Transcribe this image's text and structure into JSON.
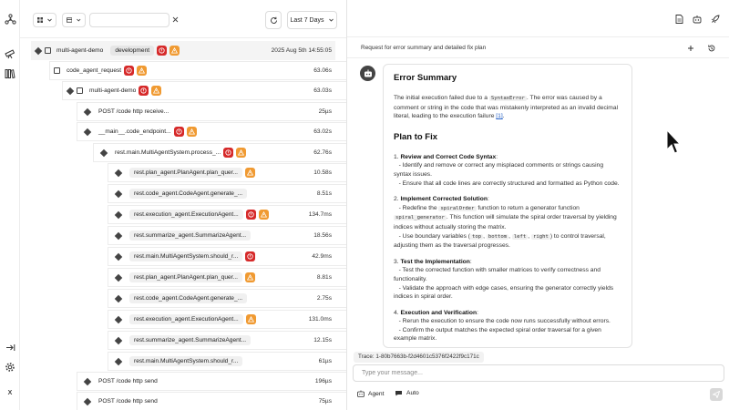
{
  "rail": {
    "logo_icon": "graph-logo-icon",
    "items": [
      {
        "icon": "telescope-icon"
      },
      {
        "icon": "library-icon"
      }
    ],
    "bottom": [
      {
        "icon": "expand-arrow-icon"
      },
      {
        "icon": "gear-icon"
      },
      {
        "label": "X"
      }
    ]
  },
  "toolbar": {
    "search_value": "",
    "time_range": "Last 7 Days"
  },
  "trace_rows": [
    {
      "name": "multi-agent-demo",
      "env": "development",
      "timestamp": "2025 Aug 5th 14:55:05",
      "err": true,
      "warn": true
    },
    {
      "name": "code_agent_request",
      "duration": "63.06s",
      "err": true,
      "warn": true
    },
    {
      "name": "multi-agent-demo",
      "duration": "63.03s",
      "err": true,
      "warn": true
    },
    {
      "name": "POST /code http receive...",
      "duration": "25µs",
      "err": false,
      "warn": false
    },
    {
      "name": "__main__.code_endpoint...",
      "duration": "63.02s",
      "err": true,
      "warn": true
    },
    {
      "name": "rest.main.MultiAgentSystem.process_...",
      "duration": "62.76s",
      "err": true,
      "warn": true
    },
    {
      "name": "rest.plan_agent.PlanAgent.plan_quer...",
      "duration": "10.58s",
      "err": false,
      "warn": true
    },
    {
      "name": "rest.code_agent.CodeAgent.generate_...",
      "duration": "8.51s",
      "err": false,
      "warn": false
    },
    {
      "name": "rest.execution_agent.ExecutionAgent...",
      "duration": "134.7ms",
      "err": true,
      "warn": true
    },
    {
      "name": "rest.summarize_agent.SummarizeAgent...",
      "duration": "18.56s",
      "err": false,
      "warn": false
    },
    {
      "name": "rest.main.MultiAgentSystem.should_r...",
      "duration": "42.9ms",
      "err": true,
      "warn": false
    },
    {
      "name": "rest.plan_agent.PlanAgent.plan_quer...",
      "duration": "8.81s",
      "err": false,
      "warn": true
    },
    {
      "name": "rest.code_agent.CodeAgent.generate_...",
      "duration": "2.75s",
      "err": false,
      "warn": false
    },
    {
      "name": "rest.execution_agent.ExecutionAgent...",
      "duration": "131.0ms",
      "err": false,
      "warn": true
    },
    {
      "name": "rest.summarize_agent.SummarizeAgent...",
      "duration": "12.15s",
      "err": false,
      "warn": false
    },
    {
      "name": "rest.main.MultiAgentSystem.should_r...",
      "duration": "61µs",
      "err": false,
      "warn": false
    },
    {
      "name": "POST /code http send",
      "duration": "196µs",
      "err": false,
      "warn": false
    },
    {
      "name": "POST /code http send",
      "duration": "75µs",
      "err": false,
      "warn": false
    }
  ],
  "chat": {
    "request_title": "Request for error summary and detailed fix plan",
    "summary_heading": "Error Summary",
    "summary": {
      "t1": "The initial execution failed due to a ",
      "code1": "SyntaxError",
      "t2": ". The error was caused by a comment or string in the code that was mistakenly interpreted as an invalid decimal literal, leading to the execution failure ",
      "ref": "[1]",
      "t3": "."
    },
    "plan_heading": "Plan to Fix",
    "steps": {
      "s1": {
        "num": "1. ",
        "title": "Review and Correct Code Syntax",
        "colon": ":",
        "b1": "- Identify and remove or correct any misplaced comments or strings causing syntax issues.",
        "b2": "- Ensure that all code lines are correctly structured and formatted as Python code."
      },
      "s2": {
        "num": "2. ",
        "title": "Implement Corrected Solution",
        "colon": ":",
        "b1a": "- Redefine the ",
        "code_a": "spiralOrder",
        "b1b": " function to return a generator function ",
        "code_b": "spiral_generator",
        "b1c": ". This function will simulate the spiral order traversal by yielding indices without actually storing the matrix.",
        "b2a": "- Use boundary variables (",
        "code_top": "top",
        "sep1": ", ",
        "code_bottom": "bottom",
        "sep2": ", ",
        "code_left": "left",
        "sep3": ", ",
        "code_right": "right",
        "b2b": ") to control traversal, adjusting them as the traversal progresses."
      },
      "s3": {
        "num": "3. ",
        "title": "Test the Implementation",
        "colon": ":",
        "b1": "- Test the corrected function with smaller matrices to verify correctness and functionality.",
        "b2": "- Validate the approach with edge cases, ensuring the generator correctly yields indices in spiral order."
      },
      "s4": {
        "num": "4. ",
        "title": "Execution and Verification",
        "colon": ":",
        "b1": "- Rerun the execution to ensure the code now runs successfully without errors.",
        "b2": "- Confirm the output matches the expected spiral order traversal for a given example matrix."
      }
    },
    "trace_id": "Trace: 1-80b7663b-f2d4601c5376f2422f9c171c",
    "input_placeholder": "Type your message...",
    "mode_agent": "Agent",
    "mode_auto": "Auto"
  }
}
